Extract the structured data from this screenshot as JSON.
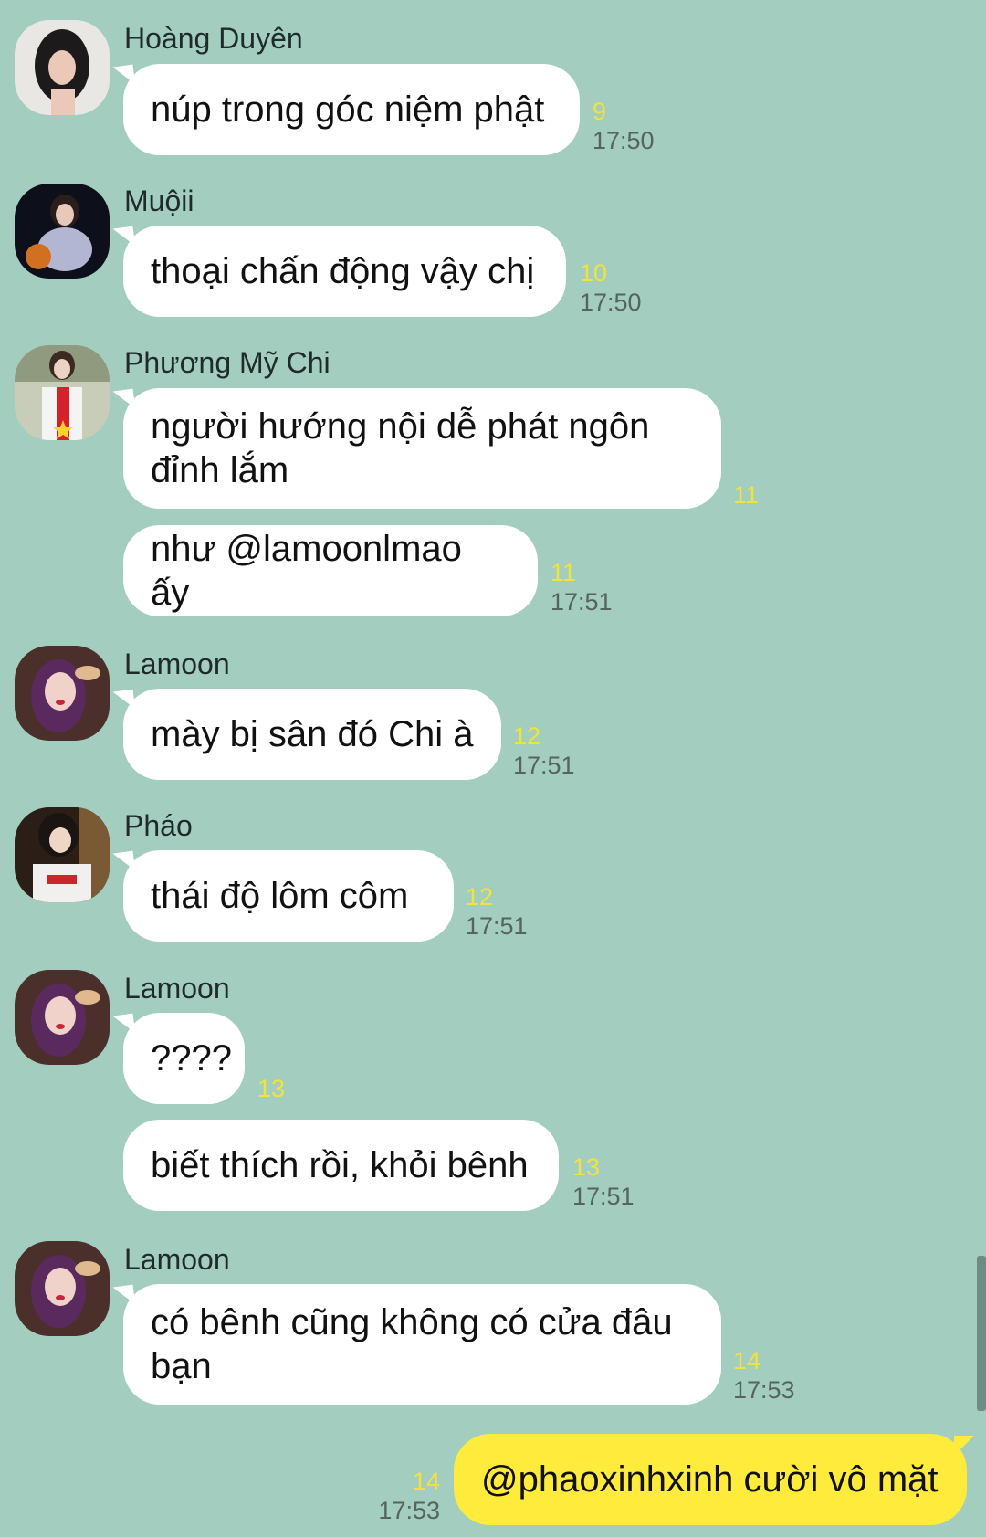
{
  "colors": {
    "background": "#a3cdbf",
    "incoming_bubble": "#ffffff",
    "outgoing_bubble": "#ffeb3b",
    "read_count": "#f1e33c",
    "timestamp": "#55645f"
  },
  "messages": [
    {
      "sender": "Hoàng Duyên",
      "text": "núp trong góc niệm phật",
      "count": "9",
      "time": "17:50"
    },
    {
      "sender": "Muộii",
      "text": "thoại chấn động vậy chị",
      "count": "10",
      "time": "17:50"
    },
    {
      "sender": "Phương Mỹ Chi",
      "text": "người hướng nội dễ phát ngôn\nđỉnh lắm",
      "count": "11",
      "time": ""
    },
    {
      "sender": "",
      "text": "như @lamoonlmao ấy",
      "count": "11",
      "time": "17:51"
    },
    {
      "sender": "Lamoon",
      "text": "mày bị sân đó Chi à",
      "count": "12",
      "time": "17:51"
    },
    {
      "sender": "Pháo",
      "text": "thái độ lôm côm",
      "count": "12",
      "time": "17:51"
    },
    {
      "sender": "Lamoon",
      "text": "????",
      "count": "13",
      "time": ""
    },
    {
      "sender": "",
      "text": "biết thích rồi, khỏi bênh",
      "count": "13",
      "time": "17:51"
    },
    {
      "sender": "Lamoon",
      "text": "có bênh cũng không có cửa đâu\nbạn",
      "count": "14",
      "time": "17:53"
    }
  ],
  "my_message": {
    "text": "@phaoxinhxinh cười vô mặt",
    "count": "14",
    "time": "17:53"
  }
}
